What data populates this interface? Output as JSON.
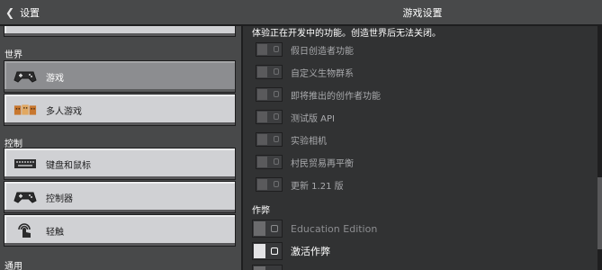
{
  "header": {
    "back_label": "设置",
    "title": "游戏设置"
  },
  "sidebar": {
    "sections": [
      {
        "label": "世界"
      },
      {
        "label": "控制"
      },
      {
        "label": "通用"
      }
    ],
    "items": [
      {
        "label": "游戏",
        "icon": "controller-icon",
        "selected": true
      },
      {
        "label": "多人游戏",
        "icon": "multiplayer-icon",
        "selected": false
      },
      {
        "label": "键盘和鼠标",
        "icon": "keyboard-icon",
        "selected": false
      },
      {
        "label": "控制器",
        "icon": "controller-icon",
        "selected": false
      },
      {
        "label": "轻触",
        "icon": "touch-icon",
        "selected": false
      }
    ]
  },
  "main": {
    "intro_text": "体验正在开发中的功能。创造世界后无法关闭。",
    "experiments": [
      {
        "label": "假日创造者功能",
        "enabled": false
      },
      {
        "label": "自定义生物群系",
        "enabled": false
      },
      {
        "label": "即将推出的创作者功能",
        "enabled": false
      },
      {
        "label": "测试版 API",
        "enabled": false
      },
      {
        "label": "实验相机",
        "enabled": false
      },
      {
        "label": "村民贸易再平衡",
        "enabled": false
      },
      {
        "label": "更新 1.21 版",
        "enabled": false
      }
    ],
    "cheats_heading": "作弊",
    "cheats": [
      {
        "label": "Education Edition",
        "enabled": false,
        "disabled": true
      },
      {
        "label": "激活作弊",
        "enabled": false,
        "disabled": false
      }
    ]
  },
  "colors": {
    "panel": "#48494a",
    "background": "#313233",
    "button": "#d0d1d4",
    "button_selected": "#8c8d90"
  }
}
